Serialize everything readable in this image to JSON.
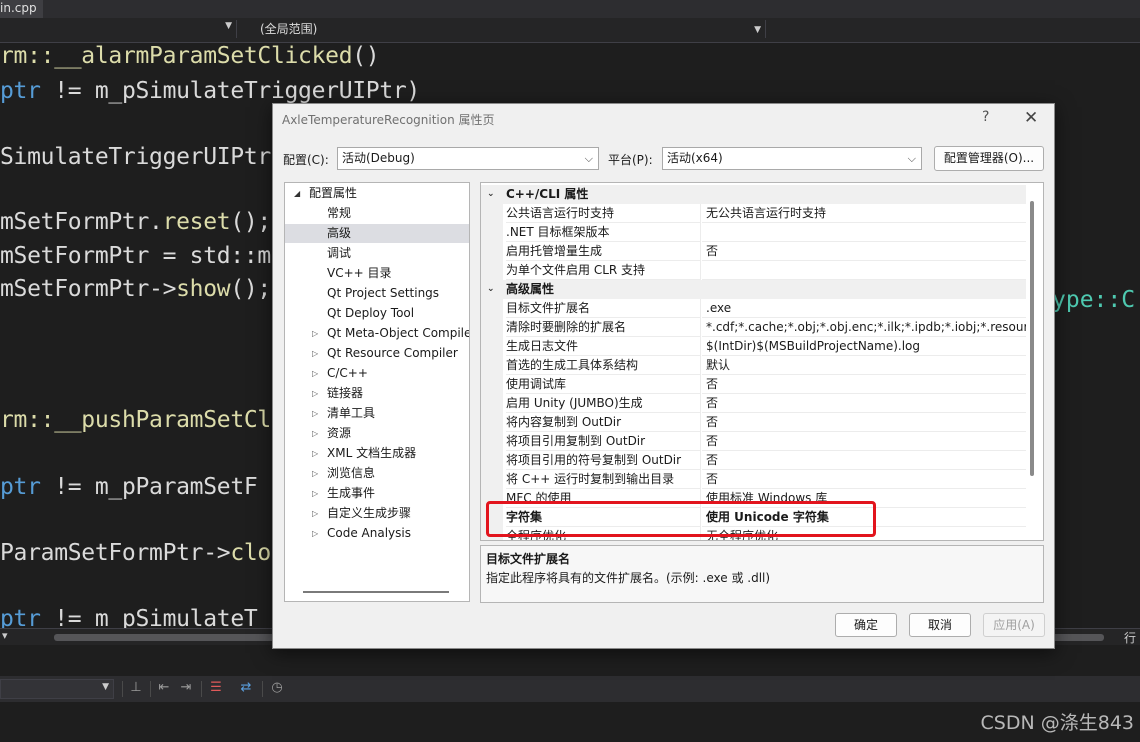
{
  "ide": {
    "file_tab": "in.cpp",
    "scope": "(全局范围)",
    "code_lines": [
      {
        "segs": [
          {
            "t": "rm::__",
            "c": "c-fn"
          },
          {
            "t": "alarmParamSetClicked",
            "c": "c-fn"
          },
          {
            "t": "()",
            "c": "c-mem"
          }
        ]
      },
      {
        "segs": [
          {
            "t": "ptr",
            "c": "c-kw"
          },
          {
            "t": " != m_pSimulateTriggerUIPtr)",
            "c": "c-mem"
          }
        ]
      },
      {
        "segs": [
          {
            "t": "SimulateTriggerUIPtr",
            "c": "c-mem"
          }
        ]
      },
      {
        "segs": [
          {
            "t": "mSetFormPtr.",
            "c": "c-mem"
          },
          {
            "t": "reset",
            "c": "c-fn"
          },
          {
            "t": "();",
            "c": "c-mem"
          }
        ]
      },
      {
        "segs": [
          {
            "t": "mSetFormPtr = std::m",
            "c": "c-mem"
          }
        ]
      },
      {
        "segs": [
          {
            "t": "mSetFormPtr->",
            "c": "c-mem"
          },
          {
            "t": "show",
            "c": "c-fn"
          },
          {
            "t": "();",
            "c": "c-mem"
          }
        ]
      },
      {
        "segs": [
          {
            "t": "rm::__",
            "c": "c-fn"
          },
          {
            "t": "pushParamSetCl",
            "c": "c-fn"
          }
        ]
      },
      {
        "segs": [
          {
            "t": "ptr",
            "c": "c-kw"
          },
          {
            "t": " != m_pParamSetF",
            "c": "c-mem"
          }
        ]
      },
      {
        "segs": [
          {
            "t": "ParamSetFormPtr->",
            "c": "c-mem"
          },
          {
            "t": "clo",
            "c": "c-fn"
          }
        ]
      },
      {
        "segs": [
          {
            "t": "ptr",
            "c": "c-kw"
          },
          {
            "t": " != m_pSimulateT",
            "c": "c-mem"
          }
        ]
      }
    ],
    "right_code": "ype::C",
    "zoom_arrow": "▾",
    "line_col": "行",
    "watermark": "CSDN @涤生843"
  },
  "dialog": {
    "title": "AxleTemperatureRecognition 属性页",
    "help": "?",
    "close": "✕",
    "config_label": "配置(C):",
    "config_value": "活动(Debug)",
    "platform_label": "平台(P):",
    "platform_value": "活动(x64)",
    "config_manager": "配置管理器(O)...",
    "tree": {
      "root": "配置属性",
      "items": [
        {
          "label": "常规",
          "expandable": false
        },
        {
          "label": "高级",
          "expandable": false,
          "selected": true
        },
        {
          "label": "调试",
          "expandable": false
        },
        {
          "label": "VC++ 目录",
          "expandable": false
        },
        {
          "label": "Qt Project Settings",
          "expandable": false
        },
        {
          "label": "Qt Deploy Tool",
          "expandable": false
        },
        {
          "label": "Qt Meta-Object Compile",
          "expandable": true
        },
        {
          "label": "Qt Resource Compiler",
          "expandable": true
        },
        {
          "label": "C/C++",
          "expandable": true
        },
        {
          "label": "链接器",
          "expandable": true
        },
        {
          "label": "清单工具",
          "expandable": true
        },
        {
          "label": "资源",
          "expandable": true
        },
        {
          "label": "XML 文档生成器",
          "expandable": true
        },
        {
          "label": "浏览信息",
          "expandable": true
        },
        {
          "label": "生成事件",
          "expandable": true
        },
        {
          "label": "自定义生成步骤",
          "expandable": true
        },
        {
          "label": "Code Analysis",
          "expandable": true
        }
      ]
    },
    "grid": {
      "categories": [
        {
          "title": "C++/CLI 属性",
          "props": [
            {
              "name": "公共语言运行时支持",
              "value": "无公共语言运行时支持"
            },
            {
              "name": ".NET 目标框架版本",
              "value": ""
            },
            {
              "name": "启用托管增量生成",
              "value": "否"
            },
            {
              "name": "为单个文件启用 CLR 支持",
              "value": ""
            }
          ]
        },
        {
          "title": "高级属性",
          "props": [
            {
              "name": "目标文件扩展名",
              "value": ".exe"
            },
            {
              "name": "清除时要删除的扩展名",
              "value": "*.cdf;*.cache;*.obj;*.obj.enc;*.ilk;*.ipdb;*.iobj;*.resources;*"
            },
            {
              "name": "生成日志文件",
              "value": "$(IntDir)$(MSBuildProjectName).log"
            },
            {
              "name": "首选的生成工具体系结构",
              "value": "默认"
            },
            {
              "name": "使用调试库",
              "value": "否"
            },
            {
              "name": "启用 Unity (JUMBO)生成",
              "value": "否"
            },
            {
              "name": "将内容复制到 OutDir",
              "value": "否"
            },
            {
              "name": "将项目引用复制到 OutDir",
              "value": "否"
            },
            {
              "name": "将项目引用的符号复制到 OutDir",
              "value": "否"
            },
            {
              "name": "将 C++ 运行时复制到输出目录",
              "value": "否"
            },
            {
              "name": "MFC 的使用",
              "value": "使用标准 Windows 库"
            },
            {
              "name": "字符集",
              "value": "使用 Unicode 字符集",
              "bold": true
            },
            {
              "name": "全程序优化",
              "value": "无全程序优化"
            }
          ]
        }
      ]
    },
    "description": {
      "title": "目标文件扩展名",
      "text": "指定此程序将具有的文件扩展名。(示例: .exe 或 .dll)"
    },
    "buttons": {
      "ok": "确定",
      "cancel": "取消",
      "apply": "应用(A)"
    }
  }
}
